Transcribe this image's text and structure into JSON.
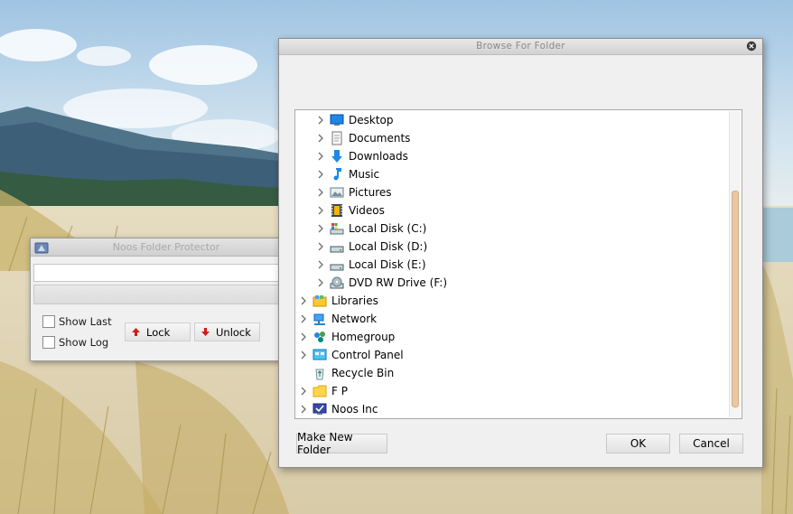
{
  "nfp": {
    "title": "Noos Folder Protector",
    "path_value": "",
    "show_last_label": "Show Last",
    "show_log_label": "Show Log",
    "lock_label": "Lock",
    "unlock_label": "Unlock"
  },
  "bff": {
    "title": "Browse For Folder",
    "tree": [
      {
        "label": "Desktop",
        "icon": "desktop-icon",
        "indent": 1,
        "expandable": true
      },
      {
        "label": "Documents",
        "icon": "documents-icon",
        "indent": 1,
        "expandable": true
      },
      {
        "label": "Downloads",
        "icon": "downloads-icon",
        "indent": 1,
        "expandable": true
      },
      {
        "label": "Music",
        "icon": "music-icon",
        "indent": 1,
        "expandable": true
      },
      {
        "label": "Pictures",
        "icon": "pictures-icon",
        "indent": 1,
        "expandable": true
      },
      {
        "label": "Videos",
        "icon": "videos-icon",
        "indent": 1,
        "expandable": true
      },
      {
        "label": "Local Disk (C:)",
        "icon": "system-drive-icon",
        "indent": 1,
        "expandable": true
      },
      {
        "label": "Local Disk (D:)",
        "icon": "drive-icon",
        "indent": 1,
        "expandable": true
      },
      {
        "label": "Local Disk (E:)",
        "icon": "drive-icon",
        "indent": 1,
        "expandable": true
      },
      {
        "label": "DVD RW Drive (F:)",
        "icon": "dvd-drive-icon",
        "indent": 1,
        "expandable": true
      },
      {
        "label": "Libraries",
        "icon": "libraries-icon",
        "indent": 0,
        "expandable": true
      },
      {
        "label": "Network",
        "icon": "network-icon",
        "indent": 0,
        "expandable": true
      },
      {
        "label": "Homegroup",
        "icon": "homegroup-icon",
        "indent": 0,
        "expandable": true
      },
      {
        "label": "Control Panel",
        "icon": "control-panel-icon",
        "indent": 0,
        "expandable": true
      },
      {
        "label": "Recycle Bin",
        "icon": "recycle-bin-icon",
        "indent": 0,
        "expandable": false
      },
      {
        "label": "F P",
        "icon": "folder-icon",
        "indent": 0,
        "expandable": true
      },
      {
        "label": "Noos Inc",
        "icon": "noos-inc-icon",
        "indent": 0,
        "expandable": true
      }
    ],
    "make_new_folder_label": "Make New Folder",
    "ok_label": "OK",
    "cancel_label": "Cancel"
  }
}
